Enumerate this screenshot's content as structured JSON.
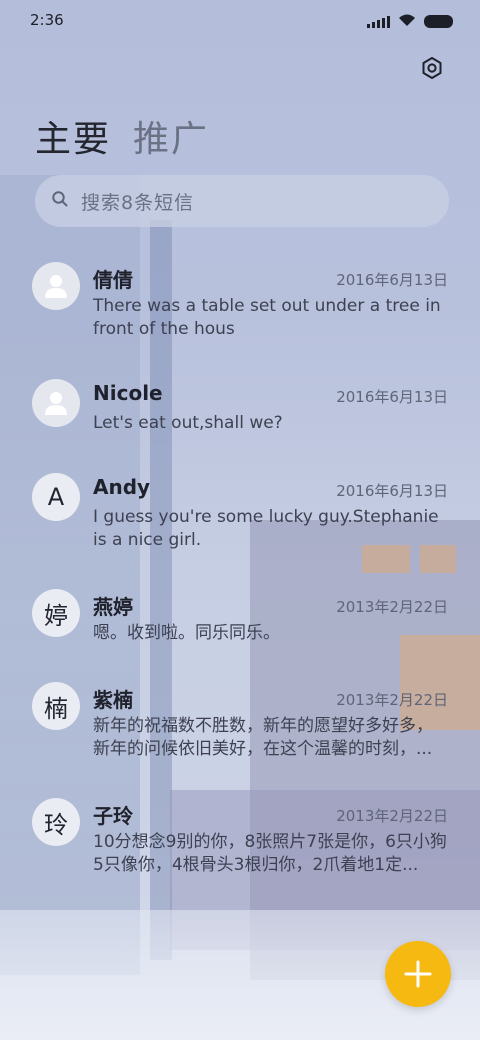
{
  "status_bar": {
    "time": "2:36"
  },
  "icons": {
    "signal": "signal-icon",
    "wifi": "wifi-icon",
    "battery": "battery-icon",
    "settings": "settings-icon",
    "search": "search-icon",
    "compose": "plus-icon",
    "avatar_person": "person-icon"
  },
  "tabs": [
    {
      "label": "主要",
      "active": true
    },
    {
      "label": "推广",
      "active": false
    }
  ],
  "search": {
    "placeholder": "搜索8条短信"
  },
  "conversations": [
    {
      "avatar_letter": "",
      "name": "倩倩",
      "date": "2016年6月13日",
      "snippet": "There was a table set out under a tree in front of the hous"
    },
    {
      "avatar_letter": "",
      "name": "Nicole",
      "date": "2016年6月13日",
      "snippet": "Let's eat out,shall we?"
    },
    {
      "avatar_letter": "A",
      "name": "Andy",
      "date": "2016年6月13日",
      "snippet": "I guess you're some lucky guy.Stephanie is a nice girl."
    },
    {
      "avatar_letter": "婷",
      "name": "燕婷",
      "date": "2013年2月22日",
      "snippet": "嗯。收到啦。同乐同乐。"
    },
    {
      "avatar_letter": "楠",
      "name": "紫楠",
      "date": "2013年2月22日",
      "snippet": "新年的祝福数不胜数，新年的愿望好多好多，新年的问候依旧美好，在这个温馨的时刻，..."
    },
    {
      "avatar_letter": "玲",
      "name": "子玲",
      "date": "2013年2月22日",
      "snippet": "10分想念9别的你，8张照片7张是你，6只小狗5只像你，4根骨头3根归你，2爪着地1定..."
    }
  ],
  "colors": {
    "accent": "#f6b911",
    "background": "#b8c1dc"
  }
}
